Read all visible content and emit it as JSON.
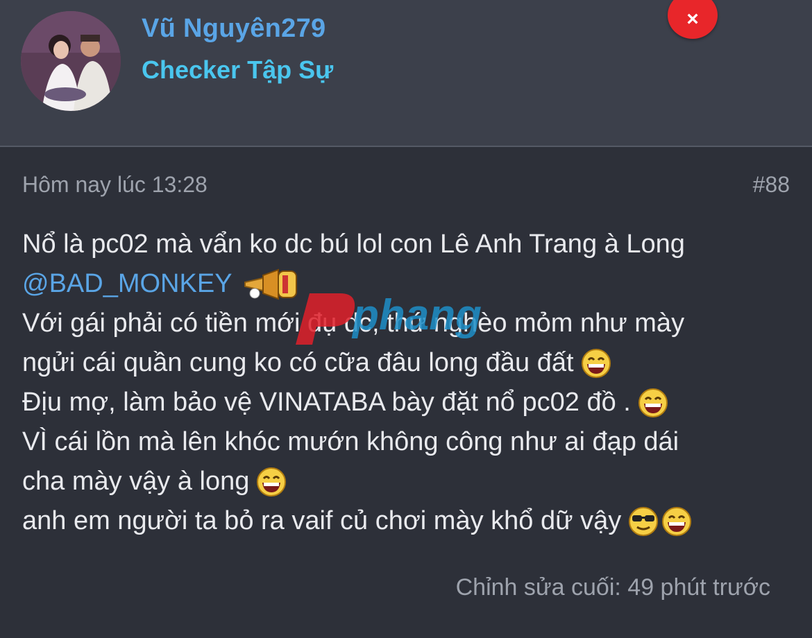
{
  "user": {
    "name": "Vũ Nguyên279",
    "title": "Checker Tập Sự"
  },
  "post": {
    "timestamp": "Hôm nay lúc 13:28",
    "number": "#88",
    "lines": [
      "Nổ là pc02 mà vẩn ko dc bú lol con Lê Anh Trang à Long",
      "@BAD_MONKEY",
      "Với gái phải có tiền mới đụ dc, thứ nghèo mỏm như mày",
      "ngửi cái quần cung ko có cữa đâu long đầu đất",
      "Địu mợ, làm bảo vệ VINATABA bày đặt nổ pc02 đồ .",
      "VÌ cái lồn mà lên khóc mướn không công như ai đạp dái",
      "cha mày vậy à long",
      "anh em người ta bỏ ra vaif củ chơi mày khổ dữ vậy"
    ],
    "edited": "Chỉnh sửa cuối: 49 phút trước"
  },
  "close_icon": "×",
  "watermark": "phang",
  "icons": {
    "avatar": "avatar",
    "close": "close-icon",
    "horn": "horn-emoji-icon",
    "laugh": "laughing-emoji-icon",
    "cool": "sunglasses-emoji-icon"
  },
  "colors": {
    "header_bg": "#3c404b",
    "body_bg": "#2d3039",
    "username": "#5aa5e6",
    "usertitle": "#4ac6ee",
    "close_button": "#e8262a"
  }
}
